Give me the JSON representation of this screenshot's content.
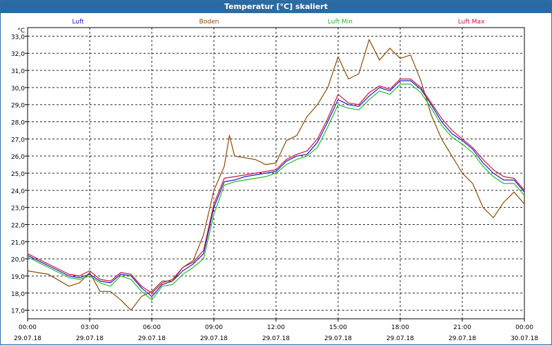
{
  "window": {
    "title": "Temperatur [°C] skaliert"
  },
  "chart_data": {
    "type": "line",
    "title": "Temperatur [°C] skaliert",
    "ylabel": "°C",
    "xlabel": "",
    "ylim": [
      16.5,
      33.5
    ],
    "yticks": [
      17.0,
      18.0,
      19.0,
      20.0,
      21.0,
      22.0,
      23.0,
      24.0,
      25.0,
      26.0,
      27.0,
      28.0,
      29.0,
      30.0,
      31.0,
      32.0,
      33.0
    ],
    "ytick_labels": [
      "17,0",
      "18,0",
      "19,0",
      "20,0",
      "21,0",
      "22,0",
      "23,0",
      "24,0",
      "25,0",
      "26,0",
      "27,0",
      "28,0",
      "29,0",
      "30,0",
      "31,0",
      "32,0",
      "33,0"
    ],
    "xlim": [
      "29.07.18 00:00",
      "30.07.18 00:00"
    ],
    "xticks": [
      {
        "time": "00:00",
        "date": "29.07.18"
      },
      {
        "time": "03:00",
        "date": "29.07.18"
      },
      {
        "time": "06:00",
        "date": "29.07.18"
      },
      {
        "time": "09:00",
        "date": "29.07.18"
      },
      {
        "time": "12:00",
        "date": "29.07.18"
      },
      {
        "time": "15:00",
        "date": "29.07.18"
      },
      {
        "time": "18:00",
        "date": "29.07.18"
      },
      {
        "time": "21:00",
        "date": "29.07.18"
      },
      {
        "time": "00:00",
        "date": "30.07.18"
      }
    ],
    "grid": true,
    "legend_position": "top",
    "series": [
      {
        "name": "Luft",
        "color": "#1a1acc",
        "points": [
          [
            "00:00",
            20.2
          ],
          [
            "01:00",
            19.6
          ],
          [
            "02:00",
            19.0
          ],
          [
            "02:30",
            18.9
          ],
          [
            "03:00",
            19.1
          ],
          [
            "03:30",
            18.7
          ],
          [
            "04:00",
            18.6
          ],
          [
            "04:30",
            19.1
          ],
          [
            "05:00",
            19.0
          ],
          [
            "05:30",
            18.3
          ],
          [
            "06:00",
            17.8
          ],
          [
            "06:30",
            18.5
          ],
          [
            "07:00",
            18.7
          ],
          [
            "07:30",
            19.3
          ],
          [
            "08:00",
            19.7
          ],
          [
            "08:30",
            20.3
          ],
          [
            "09:00",
            23.0
          ],
          [
            "09:30",
            24.5
          ],
          [
            "10:00",
            24.6
          ],
          [
            "10:30",
            24.8
          ],
          [
            "11:00",
            24.9
          ],
          [
            "11:30",
            25.0
          ],
          [
            "12:00",
            25.1
          ],
          [
            "12:30",
            25.7
          ],
          [
            "13:00",
            26.0
          ],
          [
            "13:30",
            26.1
          ],
          [
            "14:00",
            26.8
          ],
          [
            "14:30",
            28.0
          ],
          [
            "15:00",
            29.3
          ],
          [
            "15:30",
            29.0
          ],
          [
            "16:00",
            28.9
          ],
          [
            "16:30",
            29.5
          ],
          [
            "17:00",
            30.0
          ],
          [
            "17:30",
            29.8
          ],
          [
            "18:00",
            30.4
          ],
          [
            "18:30",
            30.4
          ],
          [
            "19:00",
            29.9
          ],
          [
            "19:30",
            29.0
          ],
          [
            "20:00",
            28.0
          ],
          [
            "20:30",
            27.3
          ],
          [
            "21:00",
            26.9
          ],
          [
            "21:30",
            26.4
          ],
          [
            "22:00",
            25.6
          ],
          [
            "22:30",
            25.0
          ],
          [
            "23:00",
            24.6
          ],
          [
            "23:30",
            24.6
          ],
          [
            "24:00",
            23.9
          ]
        ]
      },
      {
        "name": "Boden",
        "color": "#8a4b08",
        "points": [
          [
            "00:00",
            19.3
          ],
          [
            "01:00",
            19.1
          ],
          [
            "02:00",
            18.4
          ],
          [
            "02:30",
            18.6
          ],
          [
            "03:00",
            19.2
          ],
          [
            "03:30",
            18.1
          ],
          [
            "04:00",
            18.1
          ],
          [
            "04:30",
            17.6
          ],
          [
            "05:00",
            17.0
          ],
          [
            "05:30",
            17.8
          ],
          [
            "06:00",
            18.1
          ],
          [
            "06:30",
            18.7
          ],
          [
            "07:00",
            18.7
          ],
          [
            "07:30",
            19.5
          ],
          [
            "08:00",
            19.9
          ],
          [
            "08:30",
            21.4
          ],
          [
            "09:00",
            24.0
          ],
          [
            "09:30",
            25.4
          ],
          [
            "09:45",
            27.2
          ],
          [
            "10:00",
            26.0
          ],
          [
            "10:30",
            25.9
          ],
          [
            "11:00",
            25.8
          ],
          [
            "11:30",
            25.5
          ],
          [
            "12:00",
            25.6
          ],
          [
            "12:30",
            26.9
          ],
          [
            "13:00",
            27.2
          ],
          [
            "13:30",
            28.3
          ],
          [
            "14:00",
            29.0
          ],
          [
            "14:30",
            30.0
          ],
          [
            "15:00",
            31.8
          ],
          [
            "15:30",
            30.5
          ],
          [
            "16:00",
            30.8
          ],
          [
            "16:30",
            32.8
          ],
          [
            "17:00",
            31.6
          ],
          [
            "17:30",
            32.3
          ],
          [
            "18:00",
            31.7
          ],
          [
            "18:30",
            31.9
          ],
          [
            "19:00",
            30.4
          ],
          [
            "19:30",
            28.4
          ],
          [
            "20:00",
            27.0
          ],
          [
            "20:30",
            26.0
          ],
          [
            "21:00",
            25.0
          ],
          [
            "21:30",
            24.4
          ],
          [
            "22:00",
            23.0
          ],
          [
            "22:30",
            22.4
          ],
          [
            "23:00",
            23.3
          ],
          [
            "23:30",
            23.9
          ],
          [
            "24:00",
            23.2
          ]
        ]
      },
      {
        "name": "Luft Min",
        "color": "#22bb22",
        "points": [
          [
            "00:00",
            20.1
          ],
          [
            "01:00",
            19.5
          ],
          [
            "02:00",
            18.9
          ],
          [
            "02:30",
            18.8
          ],
          [
            "03:00",
            19.0
          ],
          [
            "03:30",
            18.6
          ],
          [
            "04:00",
            18.4
          ],
          [
            "04:30",
            19.0
          ],
          [
            "05:00",
            18.8
          ],
          [
            "05:30",
            18.1
          ],
          [
            "06:00",
            17.6
          ],
          [
            "06:30",
            18.4
          ],
          [
            "07:00",
            18.5
          ],
          [
            "07:30",
            19.1
          ],
          [
            "08:00",
            19.5
          ],
          [
            "08:30",
            20.0
          ],
          [
            "09:00",
            22.6
          ],
          [
            "09:30",
            24.3
          ],
          [
            "10:00",
            24.5
          ],
          [
            "10:30",
            24.6
          ],
          [
            "11:00",
            24.7
          ],
          [
            "11:30",
            24.8
          ],
          [
            "12:00",
            25.0
          ],
          [
            "12:30",
            25.5
          ],
          [
            "13:00",
            25.8
          ],
          [
            "13:30",
            26.0
          ],
          [
            "14:00",
            26.5
          ],
          [
            "14:30",
            27.7
          ],
          [
            "15:00",
            29.0
          ],
          [
            "15:30",
            28.8
          ],
          [
            "16:00",
            28.7
          ],
          [
            "16:30",
            29.3
          ],
          [
            "17:00",
            29.8
          ],
          [
            "17:30",
            29.6
          ],
          [
            "18:00",
            30.2
          ],
          [
            "18:30",
            30.2
          ],
          [
            "19:00",
            29.7
          ],
          [
            "19:30",
            28.8
          ],
          [
            "20:00",
            27.8
          ],
          [
            "20:30",
            27.1
          ],
          [
            "21:00",
            26.7
          ],
          [
            "21:30",
            26.2
          ],
          [
            "22:00",
            25.4
          ],
          [
            "22:30",
            24.8
          ],
          [
            "23:00",
            24.4
          ],
          [
            "23:30",
            24.4
          ],
          [
            "24:00",
            23.7
          ]
        ]
      },
      {
        "name": "Luft Max",
        "color": "#cc1144",
        "points": [
          [
            "00:00",
            20.3
          ],
          [
            "01:00",
            19.7
          ],
          [
            "02:00",
            19.1
          ],
          [
            "02:30",
            19.0
          ],
          [
            "03:00",
            19.3
          ],
          [
            "03:30",
            18.8
          ],
          [
            "04:00",
            18.7
          ],
          [
            "04:30",
            19.2
          ],
          [
            "05:00",
            19.1
          ],
          [
            "05:30",
            18.4
          ],
          [
            "06:00",
            18.0
          ],
          [
            "06:30",
            18.6
          ],
          [
            "07:00",
            18.8
          ],
          [
            "07:30",
            19.5
          ],
          [
            "08:00",
            19.8
          ],
          [
            "08:30",
            20.5
          ],
          [
            "09:00",
            23.2
          ],
          [
            "09:30",
            24.7
          ],
          [
            "10:00",
            24.8
          ],
          [
            "10:30",
            24.9
          ],
          [
            "11:00",
            25.0
          ],
          [
            "11:30",
            25.1
          ],
          [
            "12:00",
            25.2
          ],
          [
            "12:30",
            25.8
          ],
          [
            "13:00",
            26.1
          ],
          [
            "13:30",
            26.3
          ],
          [
            "14:00",
            27.0
          ],
          [
            "14:30",
            28.2
          ],
          [
            "15:00",
            29.6
          ],
          [
            "15:30",
            29.1
          ],
          [
            "16:00",
            29.0
          ],
          [
            "16:30",
            29.7
          ],
          [
            "17:00",
            30.1
          ],
          [
            "17:30",
            29.9
          ],
          [
            "18:00",
            30.5
          ],
          [
            "18:30",
            30.5
          ],
          [
            "19:00",
            30.0
          ],
          [
            "19:30",
            29.1
          ],
          [
            "20:00",
            28.2
          ],
          [
            "20:30",
            27.5
          ],
          [
            "21:00",
            27.0
          ],
          [
            "21:30",
            26.5
          ],
          [
            "22:00",
            25.8
          ],
          [
            "22:30",
            25.2
          ],
          [
            "23:00",
            24.8
          ],
          [
            "23:30",
            24.7
          ],
          [
            "24:00",
            24.0
          ]
        ]
      }
    ]
  }
}
